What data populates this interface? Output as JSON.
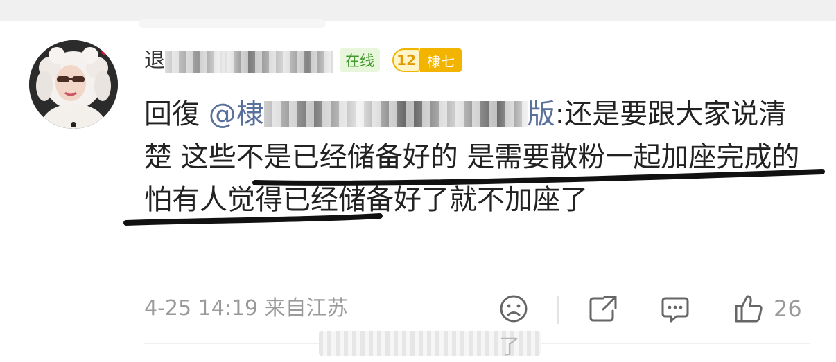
{
  "comment": {
    "username_visible": "退",
    "badges": {
      "online": "在线",
      "level_number": "12",
      "level_name": "棣七"
    },
    "reply_prefix": "回復",
    "mention_start": "@棣",
    "mention_end": "版",
    "body_after_mention": ":还是要跟大家说清楚 这些不是已经储备好的 是需要散粉一起加座完成的 怕有人觉得已经储备好了就不加座了",
    "meta": {
      "date": "4-25",
      "time": "14:19",
      "location": "来自江苏"
    },
    "actions": {
      "dislike_icon": "sad-face-icon",
      "share_icon": "share-icon",
      "comment_icon": "comment-icon",
      "like_icon": "thumbs-up-icon",
      "likes": "26"
    }
  },
  "next_row_tail": "了",
  "colors": {
    "link": "#596f9c",
    "online_badge_text": "#3f9a2a",
    "level_badge": "#f3b400",
    "meta_text": "#9a9a9a"
  }
}
